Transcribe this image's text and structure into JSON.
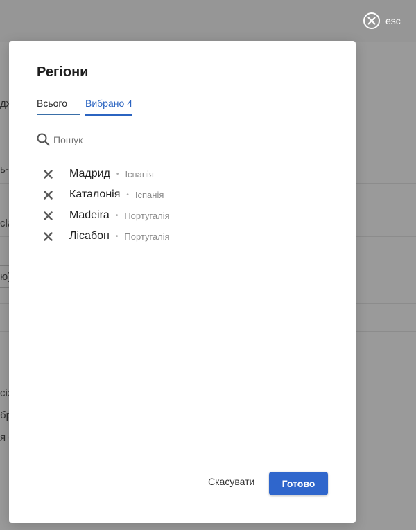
{
  "background": {
    "fragments": [
      "дж",
      "ь-",
      "cla",
      "ю)",
      "сіх",
      "бр",
      "я с"
    ]
  },
  "close": {
    "icon": "close-icon",
    "label": "esc"
  },
  "modal": {
    "title": "Регіони",
    "tabs": [
      {
        "label": "Всього",
        "active": false
      },
      {
        "label": "Вибрано 4",
        "active": true
      }
    ],
    "search": {
      "icon": "search-icon",
      "placeholder": "Пошук",
      "value": ""
    },
    "items": [
      {
        "name": "Мадрид",
        "country": "Іспанія"
      },
      {
        "name": "Каталонія",
        "country": "Іспанія"
      },
      {
        "name": "Madeira",
        "country": "Португалія"
      },
      {
        "name": "Лісабон",
        "country": "Португалія"
      }
    ],
    "separator": "•",
    "footer": {
      "cancel_label": "Скасувати",
      "done_label": "Готово"
    }
  },
  "colors": {
    "accent": "#2f66cc",
    "overlay": "#9a9a9a"
  }
}
